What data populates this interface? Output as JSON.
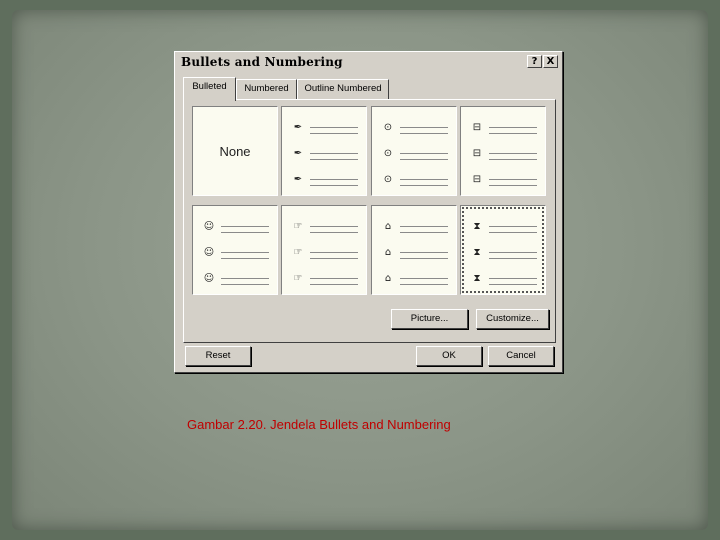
{
  "dialog": {
    "title": "Bullets and Numbering",
    "help_label": "?",
    "close_label": "X",
    "tabs": [
      "Bulleted",
      "Numbered",
      "Outline Numbered"
    ],
    "active_tab": "Bulleted",
    "none_label": "None",
    "bullet_cells": [
      {
        "icon": "pen-bullet-icon",
        "glyph": "✒"
      },
      {
        "icon": "circle-dot-bullet-icon",
        "glyph": "⊙"
      },
      {
        "icon": "disk-bullet-icon",
        "glyph": "⊟"
      },
      {
        "icon": "smiley-bullet-icon",
        "glyph": "☺"
      },
      {
        "icon": "hand-bullet-icon",
        "glyph": "☞"
      },
      {
        "icon": "folder-bullet-icon",
        "glyph": "⌂"
      },
      {
        "icon": "hourglass-bullet-icon",
        "glyph": "⧗"
      }
    ],
    "selected_cell": 6,
    "picture_button": "Picture...",
    "customize_button": "Customize...",
    "reset_button": "Reset",
    "ok_button": "OK",
    "cancel_button": "Cancel"
  },
  "caption": "Gambar 2.20. Jendela Bullets and Numbering",
  "colors": {
    "caption": "#c00000",
    "dialog_bg": "#d4d0c8",
    "slide_bg": "#8b9587"
  }
}
